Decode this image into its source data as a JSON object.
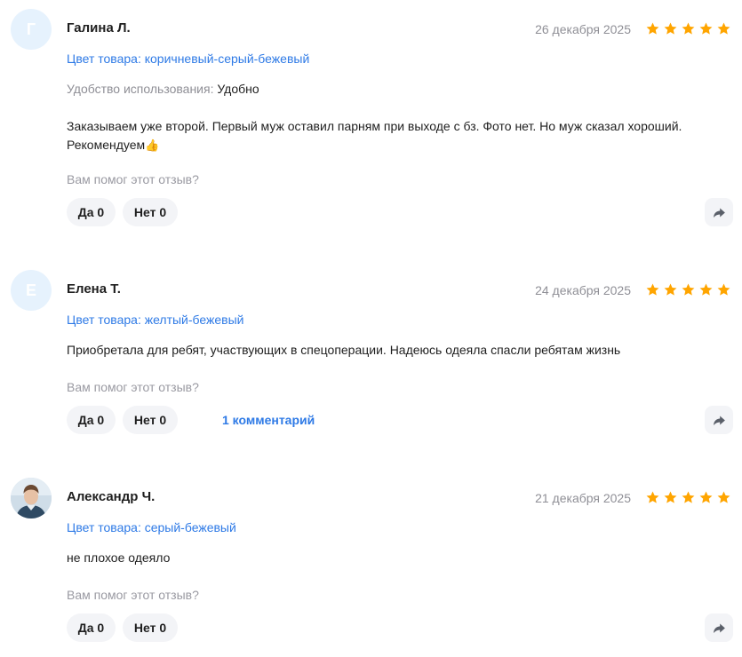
{
  "reviews": [
    {
      "avatar_letter": "Г",
      "author": "Галина Л.",
      "date": "26 декабря 2025",
      "rating": 5,
      "color_line": "Цвет товара: коричневый-серый-бежевый",
      "usability_label": "Удобство использования:",
      "usability_value": "Удобно",
      "text_line1": "Заказываем уже второй. Первый муж оставил парням при выходе с бз. Фото нет. Но муж сказал хороший.",
      "text_line2": "Рекомендуем",
      "emoji": "👍",
      "helpful": "Вам помог этот отзыв?",
      "yes_label": "Да",
      "yes_count": "0",
      "no_label": "Нет",
      "no_count": "0"
    },
    {
      "avatar_letter": "Е",
      "author": "Елена Т.",
      "date": "24 декабря 2025",
      "rating": 5,
      "color_line": "Цвет товара: желтый-бежевый",
      "text": "Приобретала для ребят, участвующих в спецоперации. Надеюсь одеяла спасли ребятам жизнь",
      "helpful": "Вам помог этот отзыв?",
      "yes_label": "Да",
      "yes_count": "0",
      "no_label": "Нет",
      "no_count": "0",
      "comments_link": "1 комментарий"
    },
    {
      "avatar_type": "photo",
      "author": "Александр Ч.",
      "date": "21 декабря 2025",
      "rating": 5,
      "color_line": "Цвет товара: серый-бежевый",
      "text": "не плохое одеяло",
      "helpful": "Вам помог этот отзыв?",
      "yes_label": "Да",
      "yes_count": "0",
      "no_label": "Нет",
      "no_count": "0"
    }
  ],
  "colors": {
    "star": "#ffa500",
    "link": "#2e7ae6",
    "muted": "#8f8f96",
    "pill_bg": "#f3f4f7"
  },
  "icons": {
    "star": "star-icon",
    "share": "share-arrow-icon"
  }
}
